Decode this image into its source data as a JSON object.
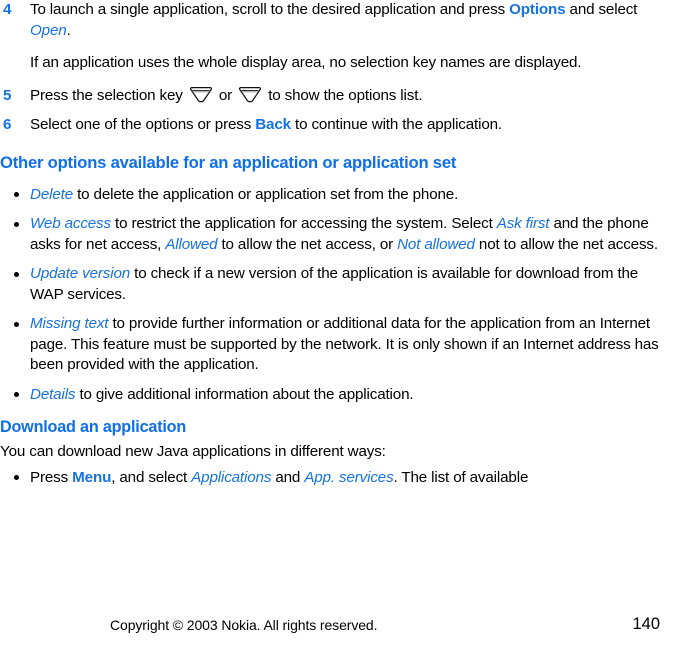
{
  "document": {
    "title": "Nokia user guide page",
    "page_number": "140",
    "accent_blue": "#1673E0",
    "heading_blue": "#0F6FE8",
    "body_color": "#000000",
    "background": "#ffffff"
  },
  "blocks": [
    {
      "type": "step",
      "number": "4",
      "runs": [
        {
          "text": "To launch a single application, scroll to the desired application and press ",
          "style": "plain"
        },
        {
          "text": "Options",
          "style": "ui-bold"
        },
        {
          "text": " and select ",
          "style": "plain"
        },
        {
          "text": "Open",
          "style": "ui-italic"
        },
        {
          "text": ".",
          "style": "plain"
        }
      ]
    },
    {
      "type": "indented",
      "runs": [
        {
          "text": "If an application uses the whole display area, no selection key names are displayed.",
          "style": "plain"
        }
      ]
    },
    {
      "type": "step",
      "number": "5",
      "runs": [
        {
          "text": "Press the selection key ",
          "style": "plain"
        },
        {
          "text": "",
          "style": "selection-key-icon"
        },
        {
          "text": " or ",
          "style": "plain"
        },
        {
          "text": "",
          "style": "selection-key-icon"
        },
        {
          "text": " to show the options list.",
          "style": "plain"
        }
      ]
    },
    {
      "type": "step",
      "number": "6",
      "runs": [
        {
          "text": "Select one of the options or press ",
          "style": "plain"
        },
        {
          "text": "Back",
          "style": "ui-bold"
        },
        {
          "text": " to continue with the application.",
          "style": "plain"
        }
      ]
    },
    {
      "type": "heading",
      "runs": [
        {
          "text": "Other options available for an application or application set",
          "style": "plain"
        }
      ]
    },
    {
      "type": "bullet",
      "runs": [
        {
          "text": "Delete",
          "style": "ui-italic"
        },
        {
          "text": " to delete the application or application set from the phone.",
          "style": "plain"
        }
      ]
    },
    {
      "type": "bullet",
      "runs": [
        {
          "text": "Web access",
          "style": "ui-italic"
        },
        {
          "text": " to restrict the application for accessing the system. Select ",
          "style": "plain"
        },
        {
          "text": "Ask first",
          "style": "ui-italic"
        },
        {
          "text": " and the phone asks for net access, ",
          "style": "plain"
        },
        {
          "text": "Allowed",
          "style": "ui-italic"
        },
        {
          "text": " to allow the net access, or ",
          "style": "plain"
        },
        {
          "text": "Not allowed",
          "style": "ui-italic"
        },
        {
          "text": " not to allow the net access.",
          "style": "plain"
        }
      ]
    },
    {
      "type": "bullet",
      "runs": [
        {
          "text": "Update version",
          "style": "ui-italic"
        },
        {
          "text": " to check if a new version of the application is available for download from the WAP services.",
          "style": "plain"
        }
      ]
    },
    {
      "type": "bullet",
      "runs": [
        {
          "text": "Missing text",
          "style": "ui-italic"
        },
        {
          "text": " to provide further information or additional data for the application from an Internet page. This feature must be supported by the network. It is only shown if an Internet address has been provided with the application.",
          "style": "plain"
        }
      ]
    },
    {
      "type": "bullet",
      "runs": [
        {
          "text": "Details",
          "style": "ui-italic"
        },
        {
          "text": " to give additional information about the application.",
          "style": "plain"
        }
      ]
    },
    {
      "type": "subheading",
      "runs": [
        {
          "text": "Download an application",
          "style": "plain"
        }
      ]
    },
    {
      "type": "plain",
      "runs": [
        {
          "text": "You can download new Java applications in different ways:",
          "style": "plain"
        }
      ]
    },
    {
      "type": "bullet",
      "runs": [
        {
          "text": "Press ",
          "style": "plain"
        },
        {
          "text": "Menu",
          "style": "ui-bold"
        },
        {
          "text": ", and select ",
          "style": "plain"
        },
        {
          "text": "Applications",
          "style": "ui-italic"
        },
        {
          "text": " and ",
          "style": "plain"
        },
        {
          "text": "App. services",
          "style": "ui-italic"
        },
        {
          "text": ". The list of available",
          "style": "plain"
        }
      ]
    }
  ],
  "footer": {
    "copyright": "Copyright © 2003 Nokia. All rights reserved.",
    "page_number": "140"
  }
}
